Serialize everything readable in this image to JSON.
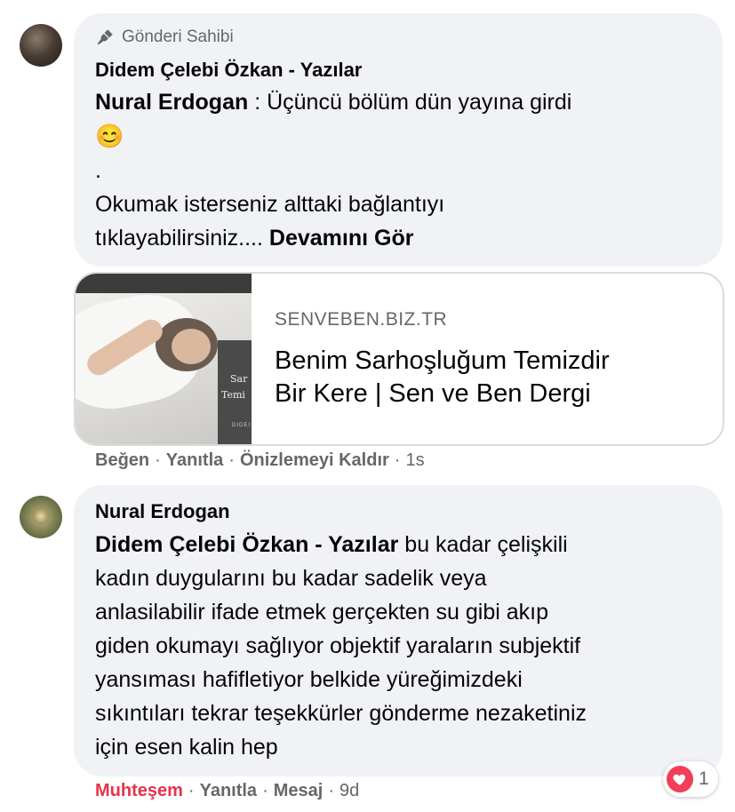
{
  "comment1": {
    "badge": "Gönderi Sahibi",
    "badge_icon": "microphone-icon",
    "author": "Didem Çelebi Özkan - Yazılar",
    "mention": "Nural Erdogan",
    "text_line1": " : Üçüncü bölüm dün yayına girdi",
    "emoji": "😊",
    "dot": ".",
    "text_line3": "Okumak isterseniz alttaki bağlantıyı",
    "text_line4": "tıklayabilirsiniz....",
    "see_more": "Devamını Gör"
  },
  "link_preview": {
    "domain": "SENVEBEN.BIZ.TR",
    "title_line1": "Benim Sarhoşluğum Temizdir",
    "title_line2": "Bir Kere | Sen ve Ben Dergi",
    "thumb_text1": "Sar",
    "thumb_text2": "Temi",
    "thumb_text3": "DIDEI"
  },
  "actions1": {
    "like": "Beğen",
    "reply": "Yanıtla",
    "remove_preview": "Önizlemeyi Kaldır",
    "time": "1s",
    "separator": "·"
  },
  "comment2": {
    "author": "Nural Erdogan",
    "mention": "Didem Çelebi Özkan - Yazılar",
    "line1_rest": " bu kadar çelişkili",
    "line2": "kadın duygularını bu kadar sadelik veya",
    "line3": "anlasilabilir ifade etmek gerçekten su gibi akıp",
    "line4": "giden okumayı sağlıyor objektif yaraların subjektif",
    "line5": "yansıması hafifletiyor belkide yüreğimizdeki",
    "line6": "sıkıntıları tekrar teşekkürler gönderme nezaketiniz",
    "line7": "için esen kalin hep"
  },
  "actions2": {
    "reaction": "Muhteşem",
    "reply": "Yanıtla",
    "message": "Mesaj",
    "time": "9d",
    "separator": "·"
  },
  "reactions": {
    "icon": "heart-icon",
    "count": "1"
  },
  "colors": {
    "bubble_bg": "#f0f2f5",
    "secondary_text": "#65676b",
    "love_red": "#e4354b",
    "heart_bg": "#f33e58"
  }
}
